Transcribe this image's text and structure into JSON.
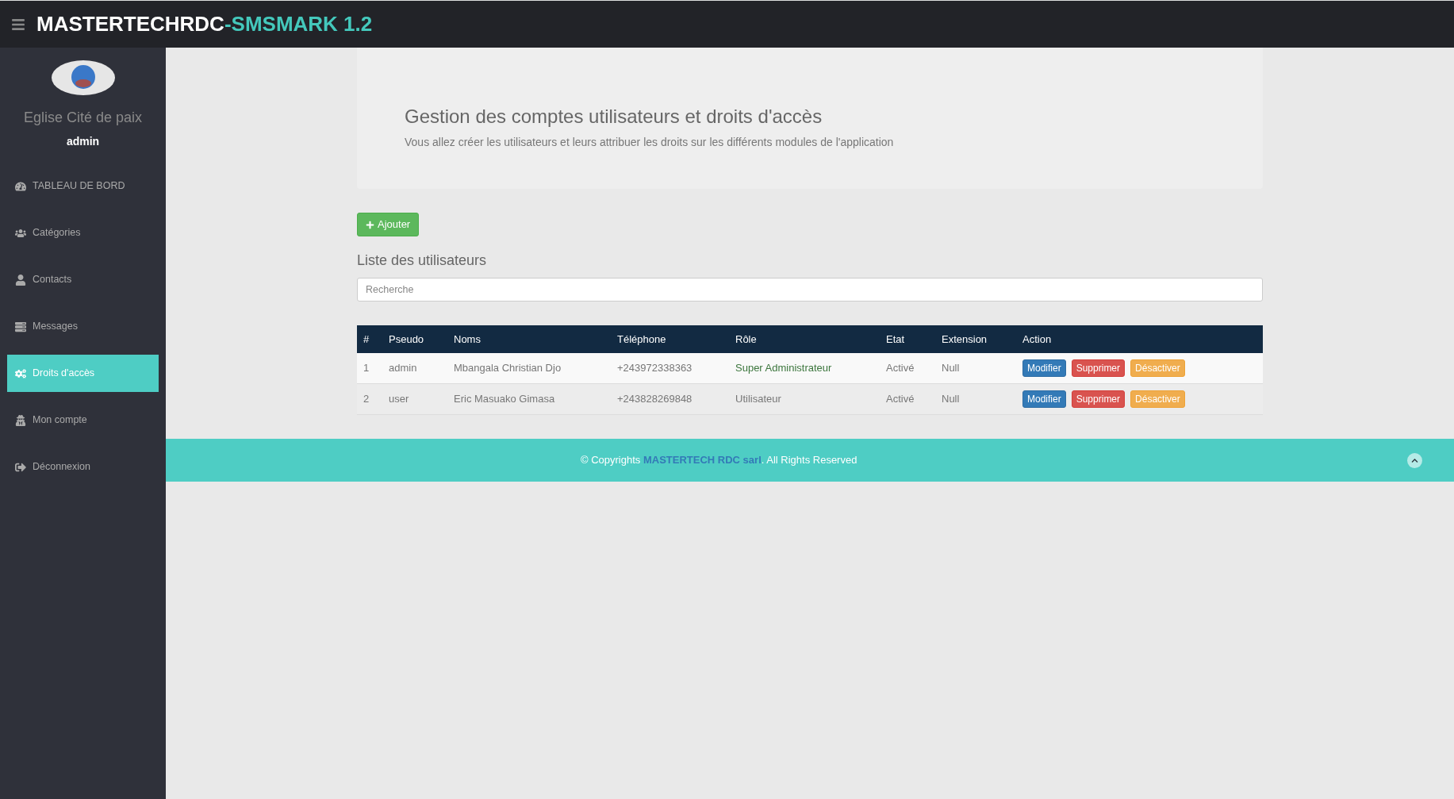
{
  "header": {
    "brand_primary": "MASTERTECHRDC",
    "brand_accent": "-SMSMARK 1.2"
  },
  "sidebar": {
    "org_name": "Eglise Cité de paix",
    "user": "admin",
    "items": [
      {
        "label": "TABLEAU DE BORD",
        "kind": "dashboard",
        "selected": false
      },
      {
        "label": "Catégories",
        "kind": "group",
        "selected": false
      },
      {
        "label": "Contacts",
        "kind": "user",
        "selected": false
      },
      {
        "label": "Messages",
        "kind": "messages",
        "selected": false
      },
      {
        "label": "Droits d'accès",
        "kind": "cogs",
        "selected": true
      },
      {
        "label": "Mon compte",
        "kind": "account",
        "selected": false
      },
      {
        "label": "Déconnexion",
        "kind": "logout",
        "selected": false
      }
    ]
  },
  "intro": {
    "title": "Gestion des comptes utilisateurs et droits d'accès",
    "subtitle": "Vous allez créer les utilisateurs et leurs attribuer les droits sur les différents modules de l'application"
  },
  "add_button": "Ajouter",
  "list_title": "Liste des utilisateurs",
  "search": {
    "placeholder": "Recherche"
  },
  "table": {
    "columns": [
      "#",
      "Pseudo",
      "Noms",
      "Téléphone",
      "Rôle",
      "Etat",
      "Extension",
      "Action"
    ],
    "rows": [
      {
        "index": "1",
        "pseudo": "admin",
        "name": "Mbangala Christian Djo",
        "phone": "+243972338363",
        "role": "Super Administrateur",
        "role_highlight": true,
        "state": "Activé",
        "extension": "Null",
        "actions": [
          {
            "label": "Modifier",
            "kind": "edit"
          },
          {
            "label": "Supprimer",
            "kind": "delete"
          },
          {
            "label": "Désactiver",
            "kind": "deactivate"
          }
        ]
      },
      {
        "index": "2",
        "pseudo": "user",
        "name": "Eric Masuako Gimasa",
        "phone": "+243828269848",
        "role": "Utilisateur",
        "role_highlight": false,
        "state": "Activé",
        "extension": "Null",
        "actions": [
          {
            "label": "Modifier",
            "kind": "edit"
          },
          {
            "label": "Supprimer",
            "kind": "delete"
          },
          {
            "label": "Désactiver",
            "kind": "deactivate"
          }
        ]
      }
    ]
  },
  "footer": {
    "before": "© Copyrights ",
    "link": "MASTERTECH RDC sarl",
    "after": ". All Rights Reserved"
  }
}
